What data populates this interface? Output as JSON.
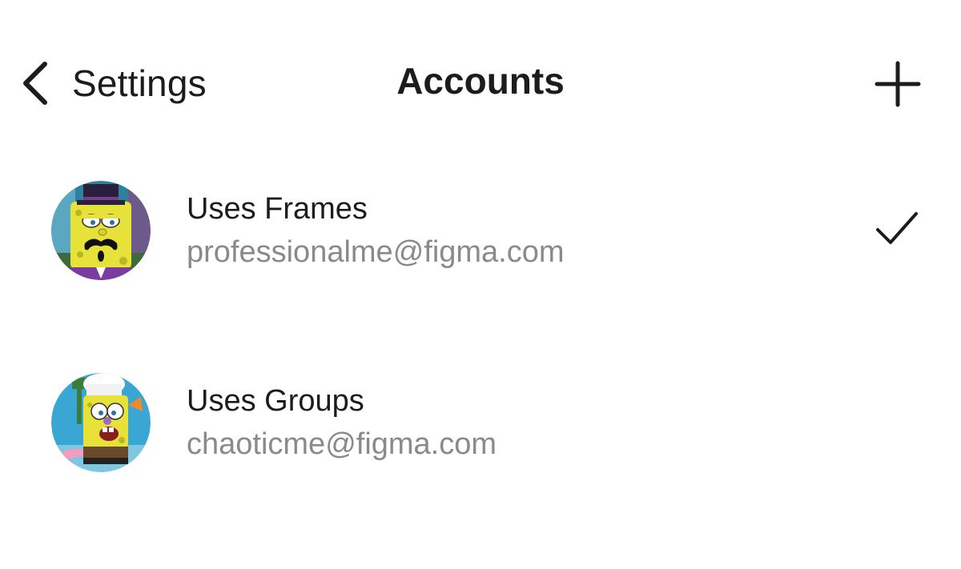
{
  "header": {
    "back_label": "Settings",
    "title": "Accounts",
    "add_icon": "plus-icon",
    "back_icon": "chevron-left-icon"
  },
  "accounts": [
    {
      "name": "Uses Frames",
      "email": "professionalme@figma.com",
      "selected": true,
      "avatar": "spongebob-top-hat-avatar"
    },
    {
      "name": "Uses Groups",
      "email": "chaoticme@figma.com",
      "selected": false,
      "avatar": "spongebob-chef-avatar"
    }
  ],
  "colors": {
    "text_primary": "#1c1c1e",
    "text_secondary": "#8a8a8e",
    "background": "#ffffff"
  }
}
